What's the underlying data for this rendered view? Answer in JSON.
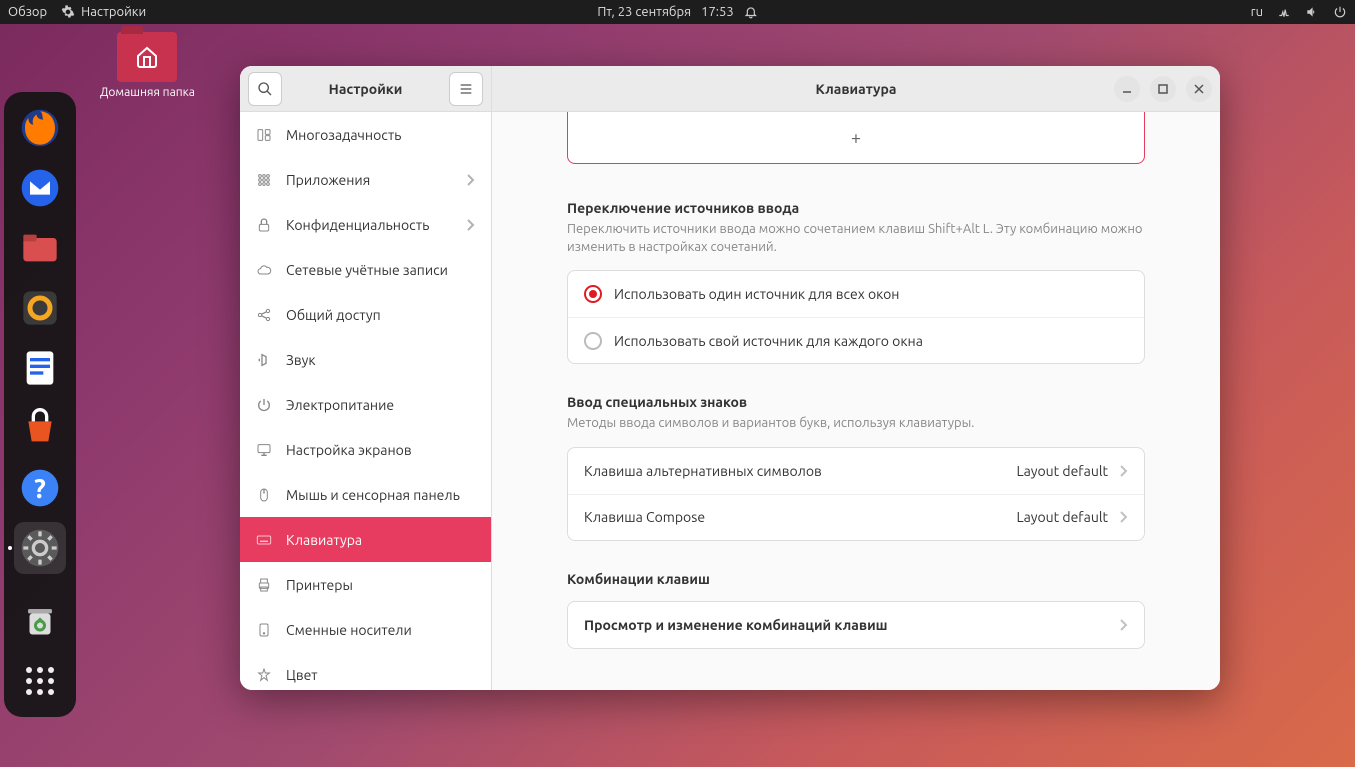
{
  "topbar": {
    "activities": "Обзор",
    "app_name": "Настройки",
    "date": "Пт, 23 сентября",
    "time": "17:53",
    "lang": "ru"
  },
  "desktop": {
    "home_folder": "Домашняя папка"
  },
  "sidebar": {
    "title": "Настройки",
    "items": [
      {
        "label": "Многозадачность",
        "icon": "multitask"
      },
      {
        "label": "Приложения",
        "icon": "apps",
        "chevron": true
      },
      {
        "label": "Конфиденциальность",
        "icon": "lock",
        "chevron": true
      },
      {
        "label": "Сетевые учётные записи",
        "icon": "cloud"
      },
      {
        "label": "Общий доступ",
        "icon": "share"
      },
      {
        "label": "Звук",
        "icon": "sound"
      },
      {
        "label": "Электропитание",
        "icon": "power"
      },
      {
        "label": "Настройка экранов",
        "icon": "display"
      },
      {
        "label": "Мышь и сенсорная панель",
        "icon": "mouse"
      },
      {
        "label": "Клавиатура",
        "icon": "keyboard",
        "selected": true
      },
      {
        "label": "Принтеры",
        "icon": "printer"
      },
      {
        "label": "Сменные носители",
        "icon": "media"
      },
      {
        "label": "Цвет",
        "icon": "color"
      }
    ]
  },
  "content": {
    "title": "Клавиатура",
    "input_switch": {
      "heading": "Переключение источников ввода",
      "sub": "Переключить источники ввода можно сочетанием клавиш Shift+Alt L. Эту комбинацию можно изменить в настройках сочетаний.",
      "opt1": "Использовать один источник для всех окон",
      "opt2": "Использовать свой источник для каждого окна"
    },
    "special": {
      "heading": "Ввод специальных знаков",
      "sub": "Методы ввода символов и вариантов букв, используя клавиатуры.",
      "alt_key_label": "Клавиша альтернативных символов",
      "alt_key_value": "Layout default",
      "compose_label": "Клавиша Compose",
      "compose_value": "Layout default"
    },
    "shortcuts": {
      "heading": "Комбинации клавиш",
      "view": "Просмотр и изменение комбинаций клавиш"
    }
  }
}
